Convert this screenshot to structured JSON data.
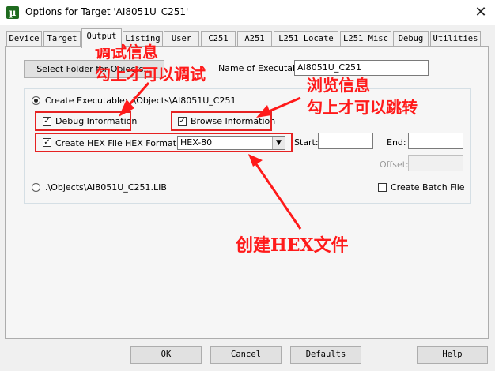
{
  "window": {
    "title": "Options for Target 'AI8051U_C251'",
    "app_icon": "µ-vision-icon",
    "close": "✕"
  },
  "tabs": [
    {
      "label": "Device",
      "active": false
    },
    {
      "label": "Target",
      "active": false
    },
    {
      "label": "Output",
      "active": true
    },
    {
      "label": "Listing",
      "active": false
    },
    {
      "label": "User",
      "active": false
    },
    {
      "label": "C251",
      "active": false
    },
    {
      "label": "A251",
      "active": false
    },
    {
      "label": "L251 Locate",
      "active": false
    },
    {
      "label": "L251 Misc",
      "active": false
    },
    {
      "label": "Debug",
      "active": false
    },
    {
      "label": "Utilities",
      "active": false
    }
  ],
  "output": {
    "select_folder_label": "Select Folder for Objects...",
    "exec_name_label": "Name of Executable:",
    "exec_name_value": "AI8051U_C251",
    "create_executable_label": "Create Executable:  .\\Objects\\AI8051U_C251",
    "create_executable_selected": true,
    "debug_info_label": "Debug Information",
    "debug_info_checked": true,
    "browse_info_label": "Browse Information",
    "browse_info_checked": true,
    "create_hex_label": "Create HEX File",
    "create_hex_checked": true,
    "hex_format_label": "HEX Format:",
    "hex_format_value": "HEX-80",
    "start_label": "Start:",
    "end_label": "End:",
    "offset_label": "Offset:",
    "create_library_label": ".\\Objects\\AI8051U_C251.LIB",
    "create_library_selected": false,
    "create_batch_label": "Create Batch File",
    "create_batch_checked": false,
    "check_mark": "✓"
  },
  "buttons": {
    "ok": "OK",
    "cancel": "Cancel",
    "defaults": "Defaults",
    "help": "Help"
  },
  "annotations": {
    "debug_line1": "调试信息",
    "debug_line2": "勾上才可以调试",
    "browse_line1": "浏览信息",
    "browse_line2": "勾上才可以跳转",
    "hex_note": "创建HEX文件"
  },
  "colors": {
    "annotation_red": "#e62222"
  }
}
